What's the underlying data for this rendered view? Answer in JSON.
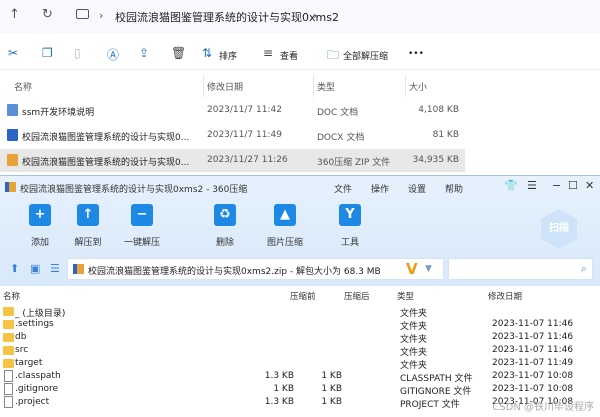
{
  "explorer": {
    "breadcrumb": [
      "校园流浪猫图鉴管理系统的设计与实现0xms2"
    ],
    "toolbar": {
      "sort": "排序",
      "view": "查看",
      "extract_all": "全部解压缩",
      "more": "•••"
    },
    "columns": [
      "名称",
      "修改日期",
      "类型",
      "大小"
    ],
    "files": [
      {
        "name": "ssm开发环境说明",
        "date": "2023/11/7 11:42",
        "type": "DOC 文档",
        "size": "4,108 KB",
        "color": "#5b8fd6"
      },
      {
        "name": "校园流浪猫图鉴管理系统的设计与实现0...",
        "date": "2023/11/7 11:49",
        "type": "DOCX 文档",
        "size": "81 KB",
        "color": "#2b65c8"
      },
      {
        "name": "校园流浪猫图鉴管理系统的设计与实现0...",
        "date": "2023/11/27 11:26",
        "type": "360压缩 ZIP 文件",
        "size": "34,935 KB",
        "color": "#e8a23a"
      }
    ]
  },
  "zip": {
    "title": "校园流浪猫图鉴管理系统的设计与实现0xms2 - 360压缩",
    "menu": [
      "文件",
      "操作",
      "设置",
      "帮助"
    ],
    "tools": [
      {
        "label": "添加",
        "glyph": "+"
      },
      {
        "label": "解压到",
        "glyph": "↑"
      },
      {
        "label": "一键解压",
        "glyph": "−"
      },
      {
        "label": "删除",
        "glyph": "♻"
      },
      {
        "label": "图片压缩",
        "glyph": "▲"
      },
      {
        "label": "工具",
        "glyph": "Y"
      }
    ],
    "scan": "扫描",
    "path": "校园流浪猫图鉴管理系统的设计与实现0xms2.zip - 解包大小为 68.3 MB",
    "columns": [
      "名称",
      "压缩前",
      "压缩后",
      "类型",
      "修改日期"
    ],
    "rows": [
      {
        "name": "_ (上级目录)",
        "before": "",
        "after": "",
        "type": "文件夹",
        "date": "",
        "folder": true
      },
      {
        "name": ".settings",
        "before": "",
        "after": "",
        "type": "文件夹",
        "date": "2023-11-07 11:46",
        "folder": true
      },
      {
        "name": "db",
        "before": "",
        "after": "",
        "type": "文件夹",
        "date": "2023-11-07 11:46",
        "folder": true
      },
      {
        "name": "src",
        "before": "",
        "after": "",
        "type": "文件夹",
        "date": "2023-11-07 11:46",
        "folder": true
      },
      {
        "name": "target",
        "before": "",
        "after": "",
        "type": "文件夹",
        "date": "2023-11-07 11:49",
        "folder": true
      },
      {
        "name": ".classpath",
        "before": "1.3 KB",
        "after": "1 KB",
        "type": "CLASSPATH 文件",
        "date": "2023-11-07 10:08",
        "folder": false
      },
      {
        "name": ".gitignore",
        "before": "1 KB",
        "after": "1 KB",
        "type": "GITIGNORE 文件",
        "date": "2023-11-07 10:08",
        "folder": false
      },
      {
        "name": ".project",
        "before": "1.3 KB",
        "after": "1 KB",
        "type": "PROJECT 文件",
        "date": "2023-11-07 10:08",
        "folder": false
      }
    ]
  },
  "watermark": "CSDN @铁川毕设程序"
}
